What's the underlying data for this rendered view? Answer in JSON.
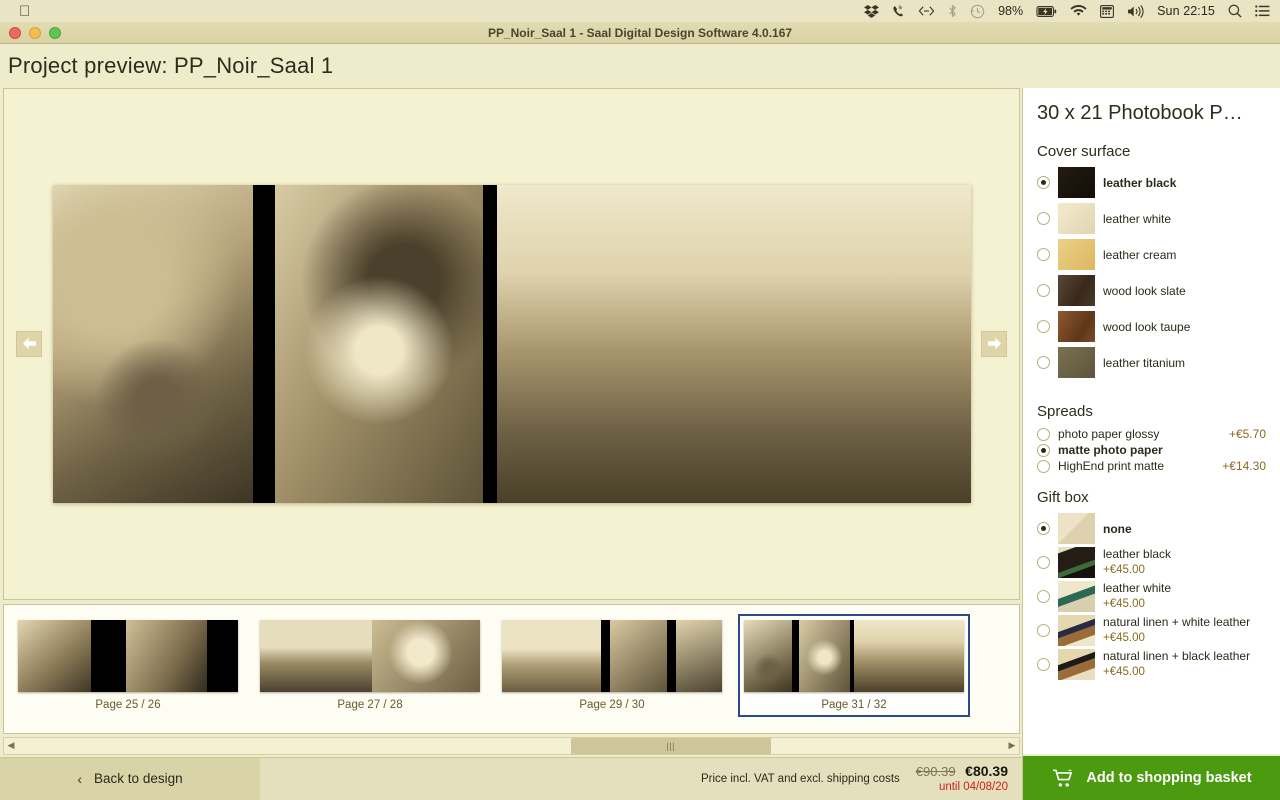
{
  "menubar": {
    "apple": "apple-logo",
    "battery_pct": "98%",
    "clock": "Sun 22:15",
    "icons": [
      "dropbox-icon",
      "phone-icon",
      "code-icon",
      "bluetooth-icon",
      "timemachine-icon",
      "battery-icon",
      "wifi-icon",
      "keyboard-icon",
      "volume-icon",
      "search-icon",
      "list-icon"
    ]
  },
  "window": {
    "title": "PP_Noir_Saal 1 - Saal Digital Design Software 4.0.167",
    "page_heading": "Project preview: PP_Noir_Saal 1"
  },
  "preview": {
    "prev_label": "previous-spread",
    "next_label": "next-spread"
  },
  "thumbnails": [
    {
      "label": "Page 25 / 26",
      "selected": false
    },
    {
      "label": "Page 27 / 28",
      "selected": false
    },
    {
      "label": "Page 29 / 30",
      "selected": false
    },
    {
      "label": "Page 31 / 32",
      "selected": true
    }
  ],
  "bottombar": {
    "back_label": "Back to design",
    "price_note": "Price incl. VAT and excl. shipping costs",
    "price_old": "€90.39",
    "price_new": "€80.39",
    "price_until": "until 04/08/20"
  },
  "panel": {
    "product_title": "30 x 21 Photobook P…",
    "cover_surface": {
      "title": "Cover surface",
      "options": [
        {
          "label": "leather black",
          "selected": true,
          "color": "#1b140e"
        },
        {
          "label": "leather white",
          "selected": false,
          "color": "#ece0c1"
        },
        {
          "label": "leather cream",
          "selected": false,
          "color": "#e5c374"
        },
        {
          "label": "wood look slate",
          "selected": false,
          "color": "#48382a"
        },
        {
          "label": "wood look taupe",
          "selected": false,
          "color": "#7a4b2a"
        },
        {
          "label": "leather titanium",
          "selected": false,
          "color": "#6b6246"
        }
      ]
    },
    "spreads": {
      "title": "Spreads",
      "options": [
        {
          "label": "photo paper glossy",
          "price": "+€5.70",
          "selected": false
        },
        {
          "label": "matte photo paper",
          "price": "",
          "selected": true
        },
        {
          "label": "HighEnd print matte",
          "price": "+€14.30",
          "selected": false
        }
      ]
    },
    "gift_box": {
      "title": "Gift box",
      "options": [
        {
          "label": "none",
          "price": "",
          "selected": true
        },
        {
          "label": "leather black",
          "price": "+€45.00",
          "selected": false
        },
        {
          "label": "leather white",
          "price": "+€45.00",
          "selected": false
        },
        {
          "label": "natural linen + white leather",
          "price": "+€45.00",
          "selected": false
        },
        {
          "label": "natural linen + black leather",
          "price": "+€45.00",
          "selected": false
        }
      ]
    },
    "basket_label": "Add to shopping basket",
    "accent_green": "#4b9a0f",
    "accent_red": "#d0211a"
  }
}
